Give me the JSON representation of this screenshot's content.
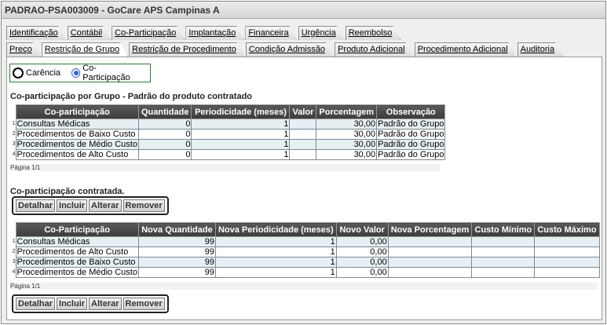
{
  "window": {
    "title": "PADRAO-PSA003009 - GoCare APS Campinas A"
  },
  "tabs_row1": [
    "Identificação",
    "Contábil",
    "Co-Participação",
    "Implantação",
    "Financeira",
    "Urgência",
    "Reembolso"
  ],
  "tabs_row2": [
    "Preço",
    "Restrição de Grupo",
    "Restrição de Procedimento",
    "Condição Admissão",
    "Produto Adicional",
    "Procedimento Adicional",
    "Auditoria"
  ],
  "active_tab": "Restrição de Grupo",
  "radio": {
    "option1": "Carência",
    "option2": "Co-Participação",
    "selected": "Co-Participação"
  },
  "section1": {
    "title": "Co-participação por Grupo - Padrão do produto contratado",
    "columns": [
      "Co-participação",
      "Quantidade",
      "Periodicidade (meses)",
      "Valor",
      "Porcentagem",
      "Observação"
    ],
    "rows": [
      [
        "1",
        "Consultas Médicas",
        "0",
        "1",
        "",
        "30,00",
        "Padrão do Grupo"
      ],
      [
        "2",
        "Procedimentos de Baixo Custo",
        "0",
        "1",
        "",
        "30,00",
        "Padrão do Grupo"
      ],
      [
        "3",
        "Procedimentos de Médio Custo",
        "0",
        "1",
        "",
        "30,00",
        "Padrão do Grupo"
      ],
      [
        "4",
        "Procedimentos de Alto Custo",
        "0",
        "1",
        "",
        "30,00",
        "Padrão do Grupo"
      ]
    ],
    "pager": "Página 1/1"
  },
  "section2": {
    "title": "Co-participação contratada.",
    "buttons": [
      "Detalhar",
      "Incluir",
      "Alterar",
      "Remover"
    ],
    "columns": [
      "Co-Participação",
      "Nova Quantidade",
      "Nova Periodicidade (meses)",
      "Novo Valor",
      "Nova Porcentagem",
      "Custo Mínimo",
      "Custo Máximo"
    ],
    "rows": [
      [
        "1",
        "Consultas Médicas",
        "99",
        "1",
        "0,00",
        "",
        "",
        ""
      ],
      [
        "2",
        "Procedimentos de Alto Custo",
        "99",
        "1",
        "0,00",
        "",
        "",
        ""
      ],
      [
        "3",
        "Procedimentos de Baixo Custo",
        "99",
        "1",
        "0,00",
        "",
        "",
        ""
      ],
      [
        "4",
        "Procedimentos de Médio Custo",
        "99",
        "1",
        "0,00",
        "",
        "",
        ""
      ]
    ],
    "pager": "Página 1/1"
  },
  "colors": {
    "header_bg": "#4a4a4a",
    "row_alt": "#e6eff2",
    "radio_border": "#2e7d32",
    "accent": "#2a62c9"
  }
}
